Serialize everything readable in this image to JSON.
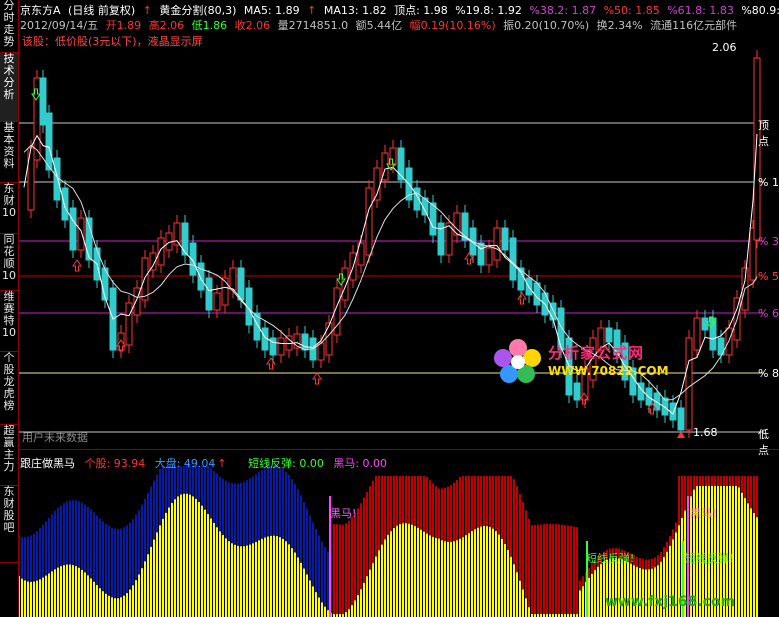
{
  "sidebar": {
    "items": [
      {
        "label": "分时走势"
      },
      {
        "label": "技术分析"
      },
      {
        "label": "基本资料"
      },
      {
        "label": "东财10"
      },
      {
        "label": "同花顺10"
      },
      {
        "label": "维赛特10"
      },
      {
        "label": "个股龙虎榜"
      },
      {
        "label": "超赢主力"
      },
      {
        "label": "东财股吧"
      }
    ]
  },
  "header": {
    "stock_name": "京东方A",
    "period": "(日线 前复权)",
    "indicator": "黄金分割(80,3)",
    "ma5": "MA5: 1.89",
    "ma13": "MA13: 1.82",
    "top_point": "顶点: 1.98",
    "p19": "%19.8: 1.92",
    "p38": "%38.2: 1.87",
    "p50": "%50: 1.85",
    "p61": "%61.8: 1.83",
    "p80": "%80.9: 1.79",
    "date": "2012/09/14/五",
    "open": "开1.89",
    "high": "高2.06",
    "low": "低1.86",
    "close": "收2.06",
    "volume": "量2714851.0",
    "amount": "额5.44亿",
    "change": "幅0.19(10.16%)",
    "amplitude": "振0.20(10.70%)",
    "turnover": "换2.34%",
    "float_cap": "流通116亿元部件",
    "note": "该股：低价股(3元以下)，液晶显示屏"
  },
  "price_labels": {
    "high_value": "2.06",
    "low_value": "1.68",
    "top_tag": "顶点",
    "bottom_tag": "低点",
    "lvl1": "1",
    "lvl3": "3",
    "lvl5": "5",
    "lvl6": "6",
    "lvl8": "8",
    "nofuture": "用户未来数据"
  },
  "sub_header": {
    "title": "跟庄做黑马",
    "stock_val": "个股: 93.94",
    "market_val": "大盘: 49.04",
    "rebound_val": "短线反弹: 0.00",
    "darkhorse_val": "黑马: 0.00"
  },
  "sub_labels": {
    "darkhorse1": "黑马",
    "darkhorse2": "黑马",
    "rebound1": "短线反弹",
    "rebound2": "短线反弹"
  },
  "watermark": {
    "title": "分析家公式网",
    "url": "WWW.70822.COM",
    "bottom": "www.fxj168.com"
  },
  "colors": {
    "up": "#ff3333",
    "down": "#33cccc",
    "ma_line": "#ffffff",
    "fib_purple": "#cc22cc",
    "fib_red": "#c00000",
    "fib_white": "#c8c8c8",
    "yellow": "#ffff00",
    "blue": "#0a1aa8",
    "darkred": "#c00000"
  }
}
